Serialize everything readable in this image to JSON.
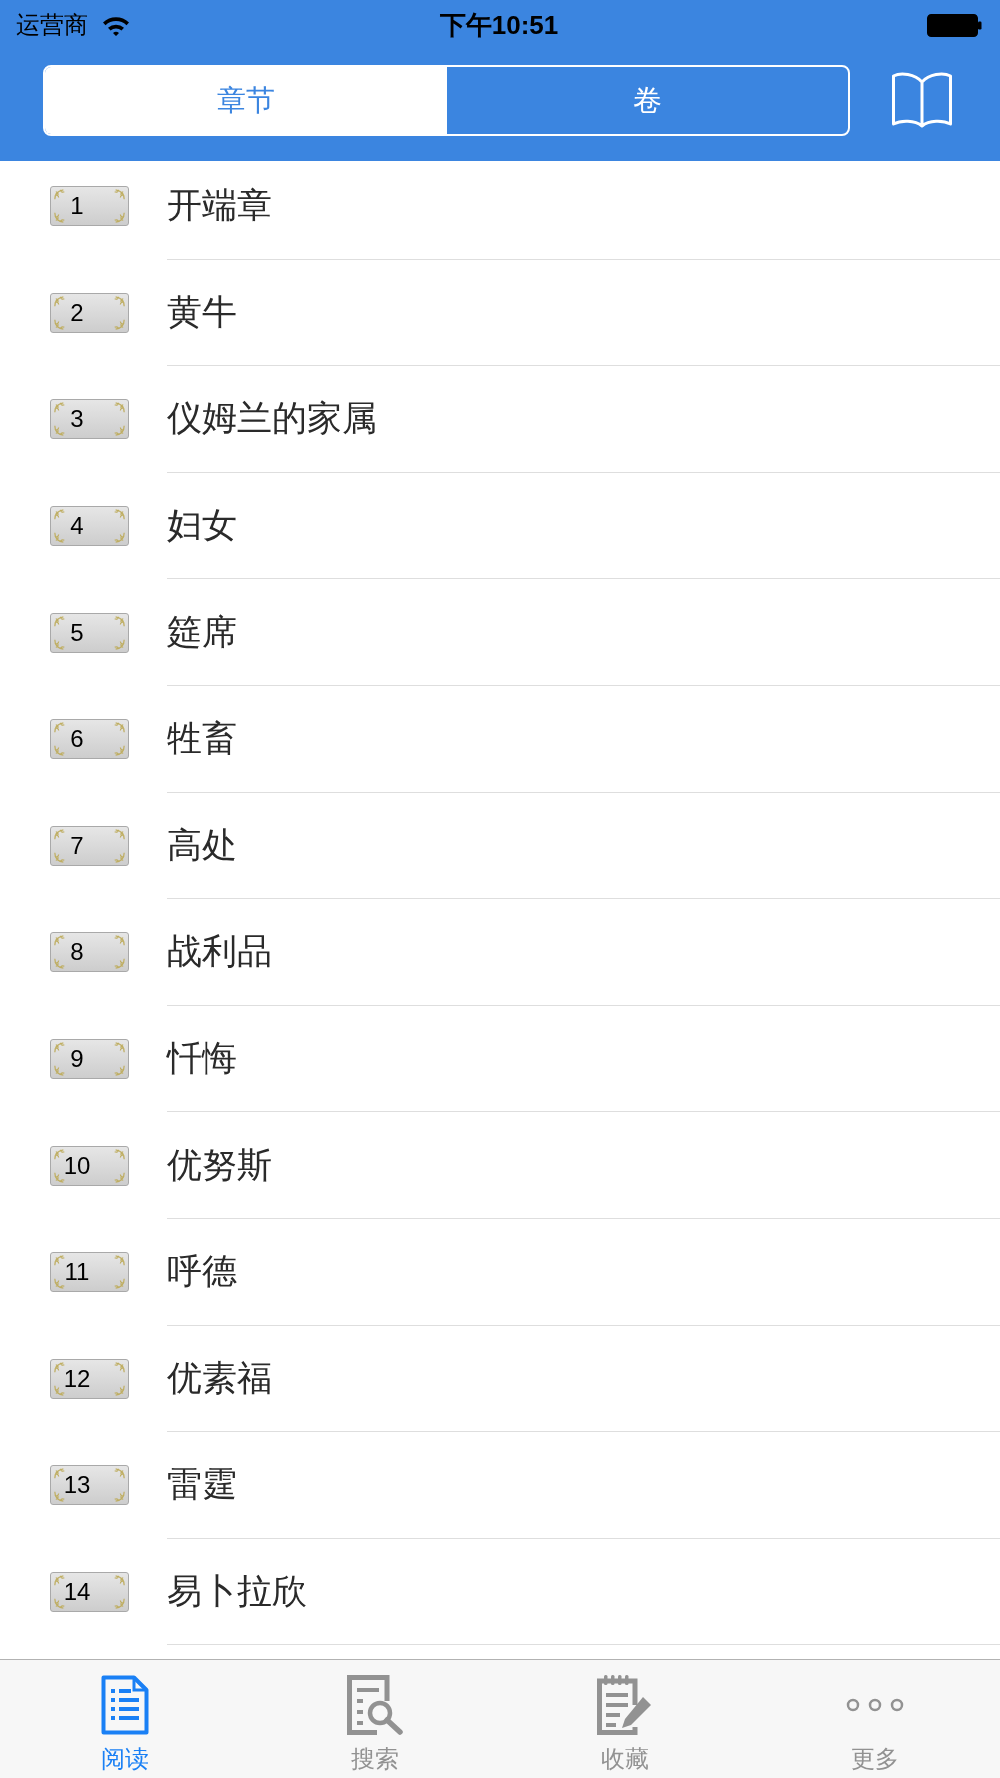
{
  "status_bar": {
    "carrier": "运营商",
    "time": "下午10:51"
  },
  "segments": [
    {
      "label": "章节",
      "selected": true
    },
    {
      "label": "卷",
      "selected": false
    }
  ],
  "chapters": [
    {
      "number": "1",
      "title": "开端章"
    },
    {
      "number": "2",
      "title": "黄牛"
    },
    {
      "number": "3",
      "title": "仪姆兰的家属"
    },
    {
      "number": "4",
      "title": "妇女"
    },
    {
      "number": "5",
      "title": "筵席"
    },
    {
      "number": "6",
      "title": "牲畜"
    },
    {
      "number": "7",
      "title": "高处"
    },
    {
      "number": "8",
      "title": "战利品"
    },
    {
      "number": "9",
      "title": "忏悔"
    },
    {
      "number": "10",
      "title": "优努斯"
    },
    {
      "number": "11",
      "title": "呼德"
    },
    {
      "number": "12",
      "title": "优素福"
    },
    {
      "number": "13",
      "title": "雷霆"
    },
    {
      "number": "14",
      "title": "易卜拉欣"
    }
  ],
  "tab_bar": [
    {
      "label": "阅读",
      "kind": "document",
      "selected": true
    },
    {
      "label": "搜索",
      "kind": "search",
      "selected": false
    },
    {
      "label": "收藏",
      "kind": "notes",
      "selected": false
    },
    {
      "label": "更多",
      "kind": "more",
      "selected": false
    }
  ]
}
